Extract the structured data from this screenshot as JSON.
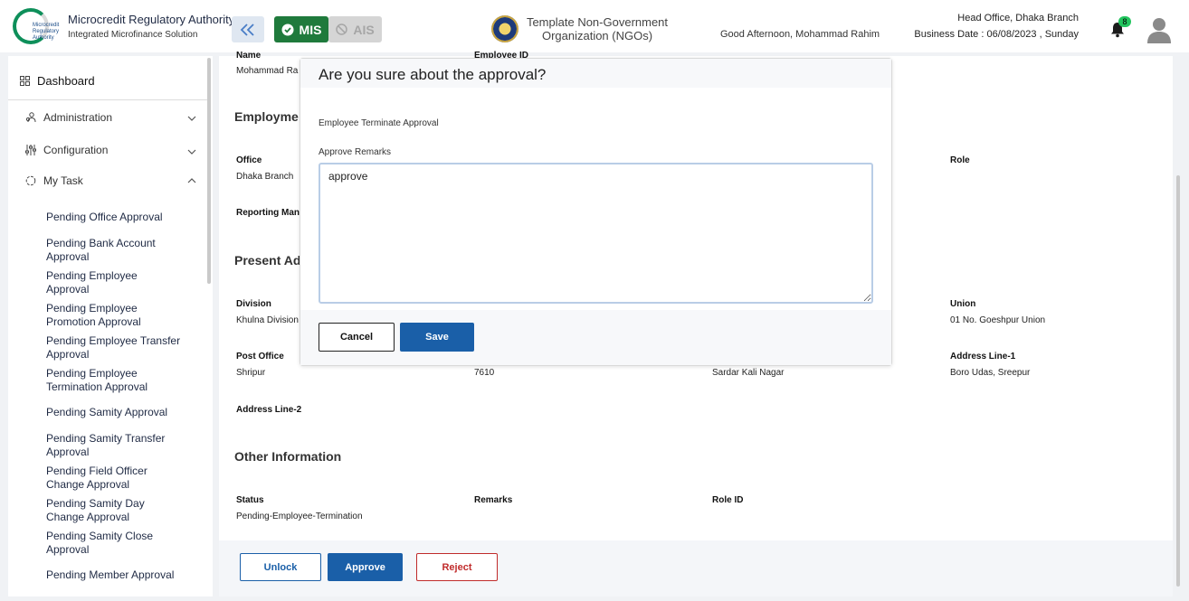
{
  "header": {
    "brand_title": "Microcredit Regulatory Authority",
    "brand_subtitle": "Integrated Microfinance Solution",
    "logo_text": "Microcredit Regulatory Authority",
    "mis_label": "MIS",
    "ais_label": "AIS",
    "org_name_line1": "Template Non-Government",
    "org_name_line2": "Organization (NGOs)",
    "greeting": "Good Afternoon, Mohammad Rahim",
    "branch": "Head Office, Dhaka Branch",
    "business_date": "Business Date : 06/08/2023 , Sunday",
    "notification_count": "8"
  },
  "sidebar": {
    "dashboard": "Dashboard",
    "administration": "Administration",
    "configuration": "Configuration",
    "my_task": "My Task",
    "tasks": [
      "Pending Office Approval",
      "Pending Bank Account Approval",
      "Pending Employee Approval",
      "Pending Employee Promotion Approval",
      "Pending Employee Transfer Approval",
      "Pending Employee Termination Approval",
      "Pending Samity Approval",
      "Pending Samity Transfer Approval",
      "Pending Field Officer Change Approval",
      "Pending Samity Day Change Approval",
      "Pending Samity Close Approval",
      "Pending Member Approval"
    ]
  },
  "main": {
    "name_label": "Name",
    "name_value": "Mohammad Ra",
    "employee_id_label": "Employee ID",
    "employment_title": "Employme",
    "office_label": "Office",
    "office_value": "Dhaka Branch",
    "role_label": "Role",
    "reporting_label": "Reporting Man",
    "present_address_title": "Present Ad",
    "division_label": "Division",
    "division_value": "Khulna Division",
    "union_label": "Union",
    "union_value": "01 No. Goeshpur Union",
    "post_office_label": "Post Office",
    "post_office_value": "Shripur",
    "post_code_value": "7610",
    "village_value": "Sardar Kali Nagar",
    "address1_label": "Address Line-1",
    "address1_value": "Boro Udas, Sreepur",
    "address2_label": "Address Line-2",
    "other_info_title": "Other Information",
    "status_label": "Status",
    "status_value": "Pending-Employee-Termination",
    "remarks_label": "Remarks",
    "role_id_label": "Role ID",
    "unlock_label": "Unlock",
    "approve_label": "Approve",
    "reject_label": "Reject"
  },
  "modal": {
    "title": "Are you sure about the approval?",
    "subtitle": "Employee Terminate Approval",
    "remarks_label": "Approve Remarks",
    "remarks_value": "approve",
    "cancel_label": "Cancel",
    "save_label": "Save"
  },
  "colors": {
    "primary": "#1a5fa8",
    "mis_green": "#1f7a3c",
    "reject_red": "#c02b2b",
    "badge_green": "#22c55e"
  }
}
